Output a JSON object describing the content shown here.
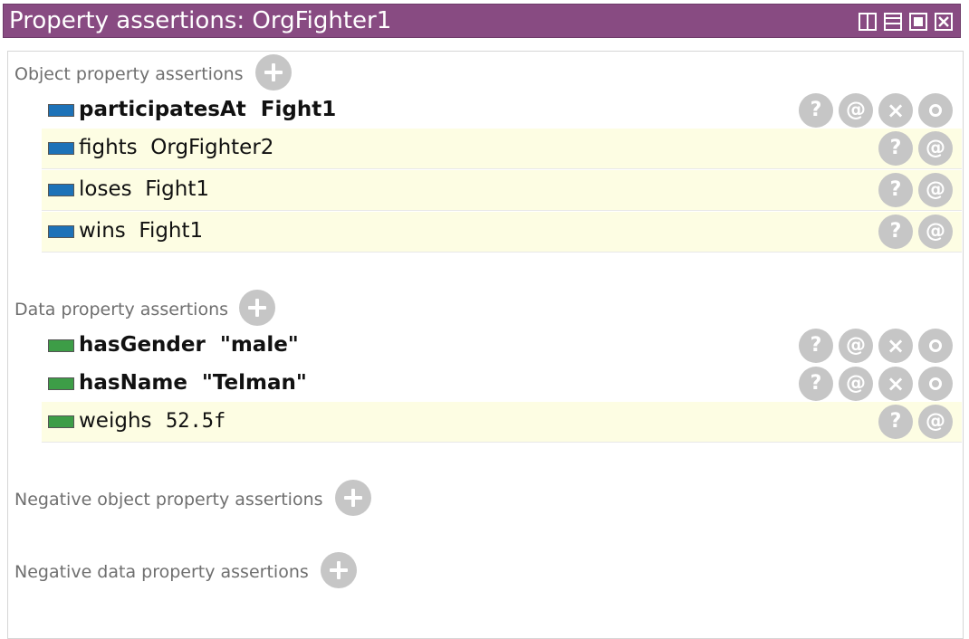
{
  "window": {
    "title": "Property assertions: OrgFighter1"
  },
  "sections": {
    "object": {
      "label": "Object property assertions"
    },
    "data": {
      "label": "Data property assertions"
    },
    "neg_object": {
      "label": "Negative object property assertions"
    },
    "neg_data": {
      "label": "Negative data property assertions"
    }
  },
  "object_assertions": [
    {
      "property": "participatesAt",
      "value": "Fight1",
      "text": "participatesAt  Fight1",
      "inferred": false
    },
    {
      "property": "fights",
      "value": "OrgFighter2",
      "text": "fights  OrgFighter2",
      "inferred": true
    },
    {
      "property": "loses",
      "value": "Fight1",
      "text": "loses  Fight1",
      "inferred": true
    },
    {
      "property": "wins",
      "value": "Fight1",
      "text": "wins  Fight1",
      "inferred": true
    }
  ],
  "data_assertions": [
    {
      "property": "hasGender",
      "value": "\"male\"",
      "text": "hasGender  \"male\"",
      "inferred": false
    },
    {
      "property": "hasName",
      "value": "\"Telman\"",
      "text": "hasName  \"Telman\"",
      "inferred": false
    },
    {
      "property": "weighs",
      "value": "52.5f",
      "text_prop": "weighs",
      "text_val": "52.5f",
      "inferred": true
    }
  ],
  "buttons": {
    "explain": "?",
    "annotate": "@",
    "delete": "×"
  },
  "colors": {
    "title_bar": "#884b82",
    "object_property": "#1d72b8",
    "data_property": "#3d9d47",
    "inferred_row": "#fdfde3",
    "button": "#c6c6c6"
  }
}
